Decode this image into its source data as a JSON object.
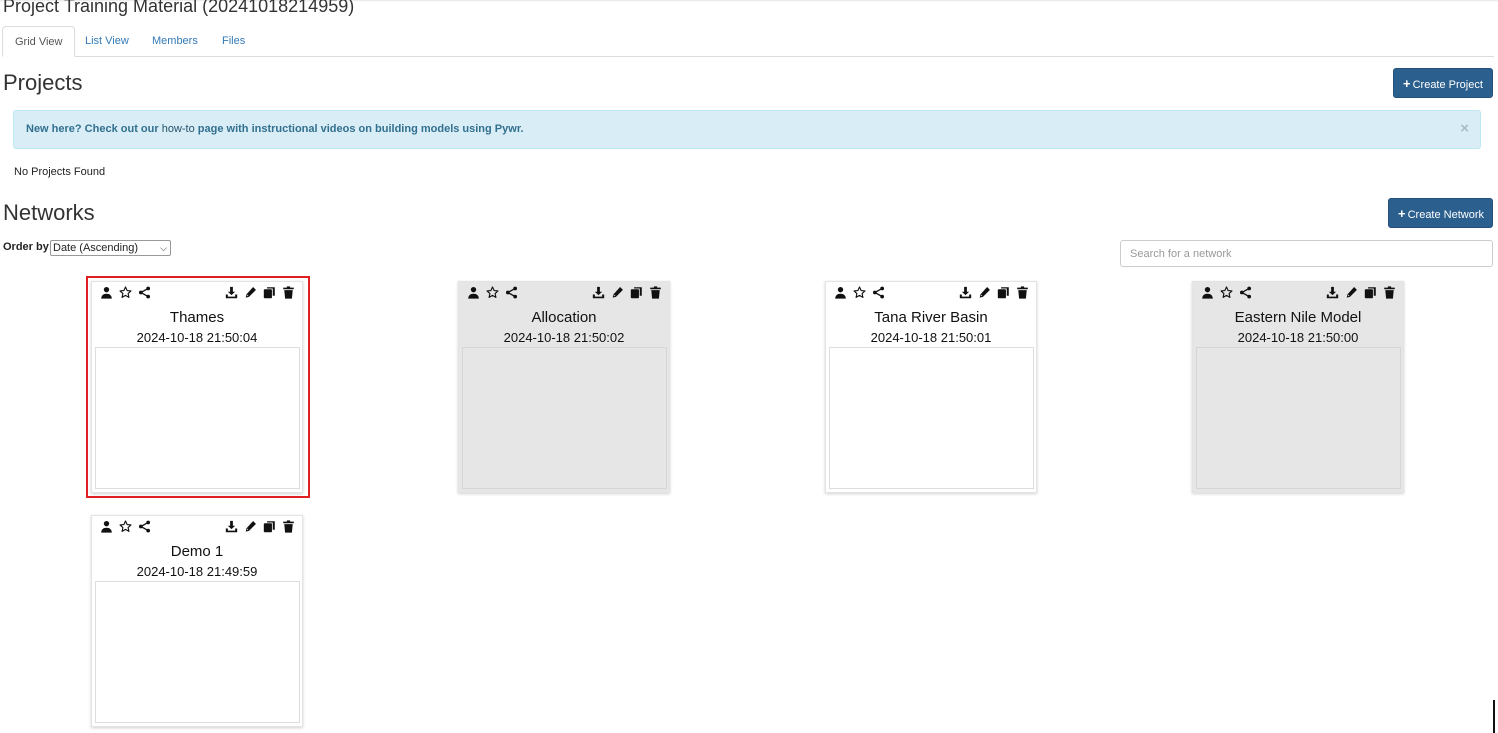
{
  "page": {
    "title": "Project Training Material (20241018214959)"
  },
  "tabs": [
    "Grid View",
    "List View",
    "Members",
    "Files"
  ],
  "projects": {
    "heading": "Projects",
    "create_label": "Create Project",
    "alert": {
      "prefix": "New here? Check out our ",
      "link_text": "how-to",
      "suffix": " page with instructional videos on building models using Pywr.",
      "close": "×"
    },
    "empty_text": "No Projects Found"
  },
  "networks": {
    "heading": "Networks",
    "create_label": "Create Network",
    "order_label": "Order by:",
    "order_value": "Date (Ascending)",
    "search_placeholder": "Search for a network",
    "items": [
      {
        "name": "Thames",
        "date": "2024-10-18 21:50:04"
      },
      {
        "name": "Allocation",
        "date": "2024-10-18 21:50:02"
      },
      {
        "name": "Tana River Basin",
        "date": "2024-10-18 21:50:01"
      },
      {
        "name": "Eastern Nile Model",
        "date": "2024-10-18 21:50:00"
      },
      {
        "name": "Demo 1",
        "date": "2024-10-18 21:49:59"
      }
    ]
  },
  "icons": [
    "user-icon",
    "star-icon",
    "share-icon",
    "download-icon",
    "pencil-icon",
    "copy-icon",
    "trash-icon"
  ],
  "colors": {
    "primary": "#2b5f8e",
    "link": "#337ab7",
    "alert_bg": "#d9edf7",
    "highlight": "#e02020"
  }
}
